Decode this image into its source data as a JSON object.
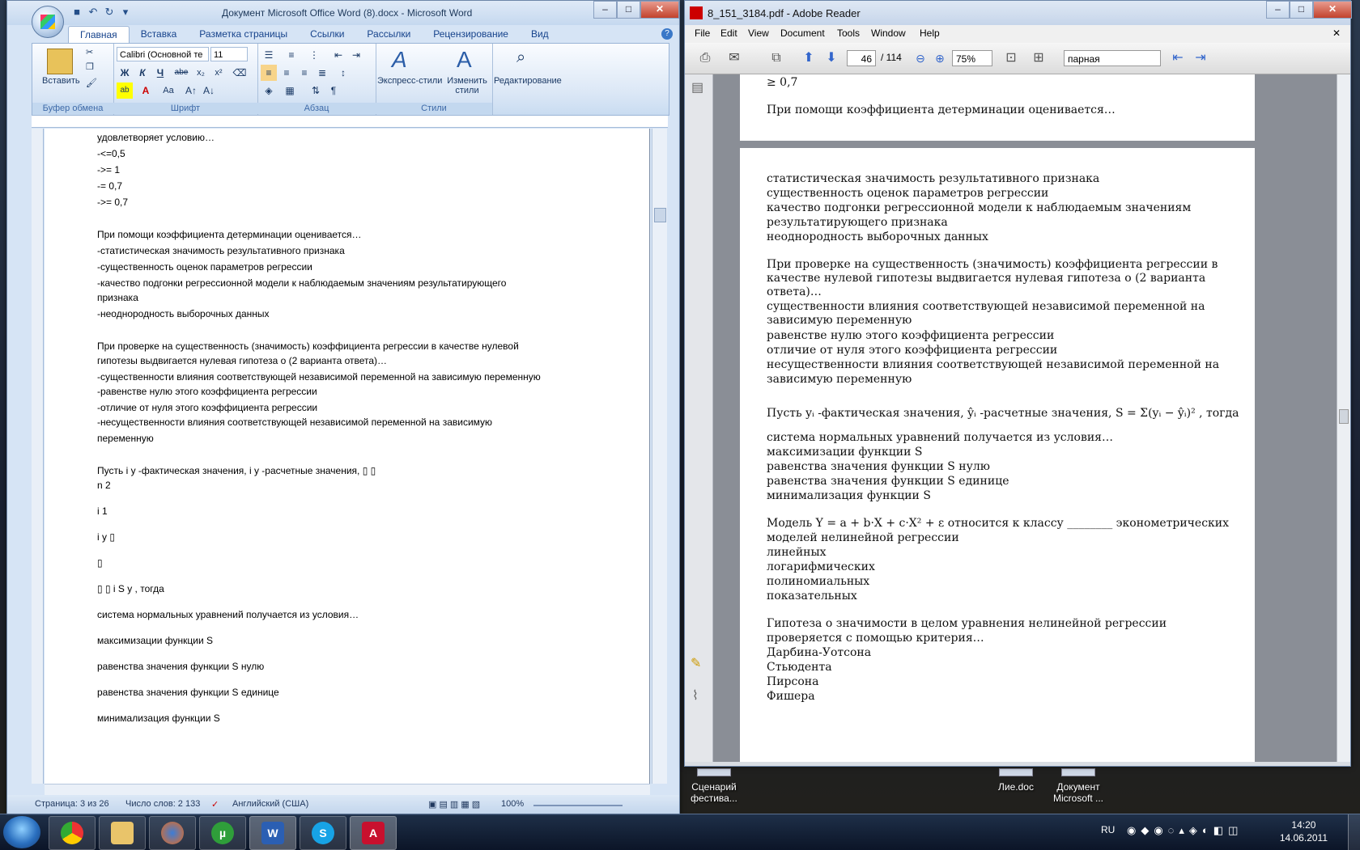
{
  "desktop": {
    "icons": [
      {
        "label": "Сценарий фестива..."
      },
      {
        "label": "Лие.doc"
      },
      {
        "label": "Документ Microsoft ..."
      }
    ]
  },
  "word": {
    "title": "Документ Microsoft Office Word (8).docx - Microsoft Word",
    "tabs": [
      "Главная",
      "Вставка",
      "Разметка страницы",
      "Ссылки",
      "Рассылки",
      "Рецензирование",
      "Вид"
    ],
    "ribbon": {
      "paste_label": "Вставить",
      "font_name": "Calibri (Основной те",
      "font_size": "11",
      "groups": [
        "Буфер обмена",
        "Шрифт",
        "Абзац",
        "Стили"
      ],
      "express_styles": "Экспресс-стили",
      "change_styles": "Изменить стили",
      "editing": "Редактирование"
    },
    "lines": [
      "удовлетворяет условию…",
      "-<=0,5",
      "->= 1",
      "-= 0,7",
      "->= 0,7",
      "",
      "При помощи коэффициента детерминации оценивается…",
      "-статистическая значимость результативного признака",
      "-существенность оценок параметров регрессии",
      "-качество подгонки регрессионной модели к наблюдаемым значениям результатирующего",
      "признака",
      "-неоднородность выборочных данных",
      "",
      "При проверке на существенность (значимость) коэффициента регрессии в качестве нулевой",
      "гипотезы выдвигается нулевая гипотеза о (2 варианта ответа)…",
      "-существенности влияния соответствующей независимой переменной на зависимую переменную",
      "-равенстве нулю этого коэффициента регрессии",
      "-отличие от нуля этого коэффициента регрессии",
      "-несущественности влияния соответствующей независимой переменной на зависимую",
      "переменную",
      "",
      "Пусть i y -фактическая значения, i y -расчетные значения, ▯ ▯",
      "n 2",
      "",
      "i 1",
      "",
      "i y ▯",
      "",
      "▯",
      "",
      "▯ ▯ i S y , тогда",
      "",
      "система нормальных уравнений получается из условия…",
      "",
      "максимизации функции S",
      "",
      "равенства значения функции S нулю",
      "",
      "равенства значения функции S единице",
      "",
      "минимализация функции S"
    ],
    "status": {
      "page": "Страница: 3 из 26",
      "words": "Число слов: 2 133",
      "language": "Английский (США)",
      "zoom": "100%"
    }
  },
  "reader": {
    "title": "8_151_3184.pdf - Adobe Reader",
    "menu": [
      "File",
      "Edit",
      "View",
      "Document",
      "Tools",
      "Window",
      "Help"
    ],
    "page_current": "46",
    "page_total": "/ 114",
    "zoom": "75%",
    "layout_mode": "парная",
    "top_lines": [
      "≥ 0,7",
      "При помощи коэффициента детерминации оценивается…"
    ],
    "lines": [
      "статистическая значимость результативного признака",
      "существенность оценок параметров регрессии",
      "качество подгонки регрессионной модели к наблюдаемым значениям",
      "результатирующего признака",
      "неоднородность выборочных данных",
      "",
      "При проверке на существенность (значимость) коэффициента регрессии в",
      "качестве нулевой гипотезы выдвигается нулевая гипотеза о (2 варианта",
      "ответа)…",
      "существенности влияния соответствующей независимой переменной на",
      "зависимую переменную",
      "равенстве нулю этого коэффициента регрессии",
      "отличие от нуля этого коэффициента регрессии",
      "несущественности влияния соответствующей независимой переменной на",
      "зависимую переменную"
    ],
    "formula_line": "Пусть yᵢ -фактическая значения, ŷᵢ -расчетные значения, S = Σ(yᵢ − ŷᵢ)² , тогда",
    "lines2": [
      "система нормальных уравнений получается из условия…",
      "максимизации функции S",
      "равенства значения функции S нулю",
      "равенства значения функции S единице",
      "минимализация функции S",
      "",
      "Модель  Y = a + b·X + c·X² + ε  относится к классу ________ эконометрических",
      "моделей нелинейной регрессии",
      "линейных",
      "логарифмических",
      "полиномиальных",
      "показательных",
      "",
      "Гипотеза о значимости в целом уравнения нелинейной регрессии",
      "проверяется с помощью критерия…",
      "Дарбина-Уотсона",
      "Стьюдента",
      "Пирсона",
      "Фишера"
    ]
  },
  "taskbar": {
    "lang": "RU",
    "time": "14:20",
    "date": "14.06.2011"
  }
}
